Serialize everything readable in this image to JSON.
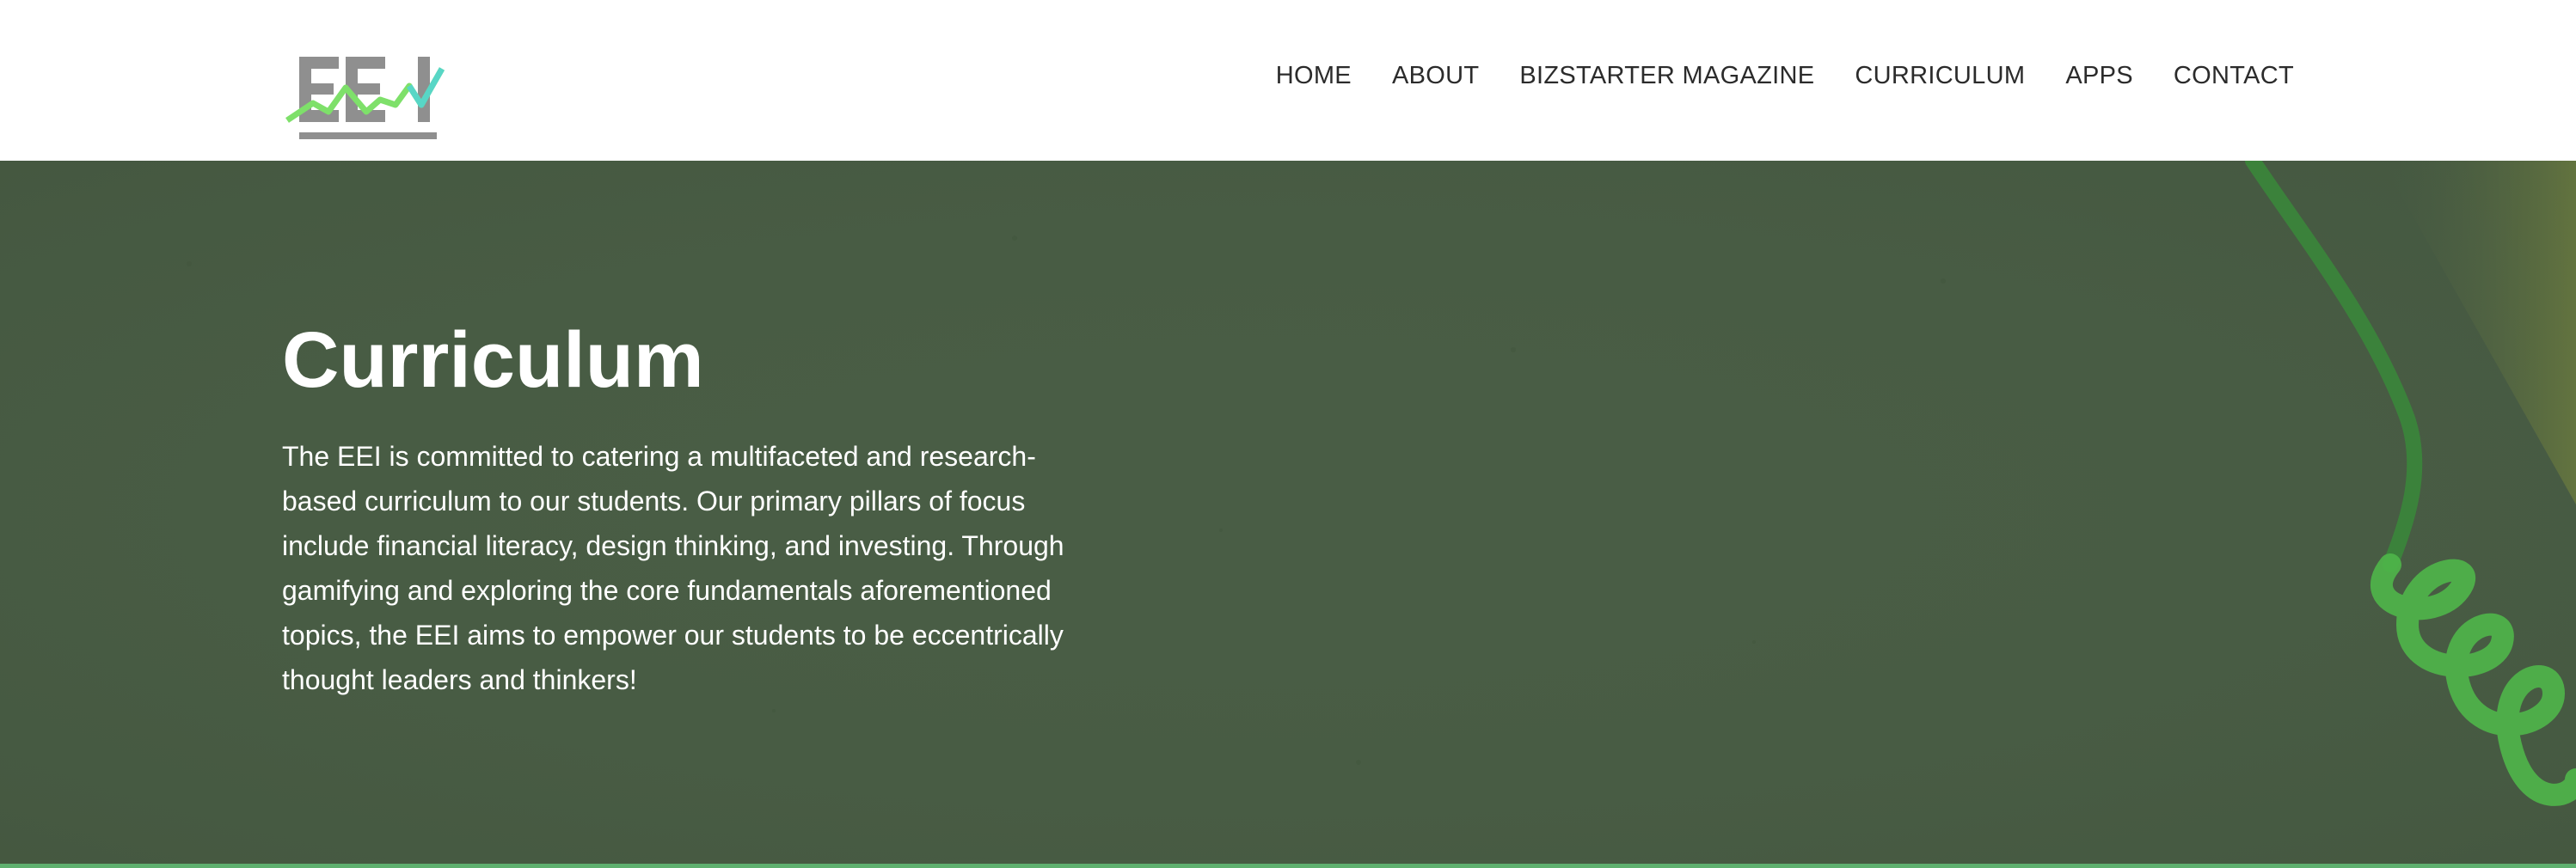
{
  "header": {
    "logo_text": "EEI",
    "nav": [
      {
        "label": "HOME"
      },
      {
        "label": "ABOUT"
      },
      {
        "label": "BIZSTARTER MAGAZINE"
      },
      {
        "label": "CURRICULUM"
      },
      {
        "label": "APPS"
      },
      {
        "label": "CONTACT"
      }
    ]
  },
  "hero": {
    "title": "Curriculum",
    "body": "The EEI is committed to catering a multifaceted and research-based curriculum to our students. Our primary pillars of focus include financial literacy, design thinking, and investing. Through gamifying and exploring the core fundamentals aforementioned topics, the EEI aims to empower our students to be eccentrically thought leaders and thinkers!"
  },
  "colors": {
    "hero_background": "#495d45",
    "logo_gray": "#8f8f8f",
    "logo_green": "#7ee06a",
    "logo_teal": "#58d6c6",
    "accent_bar": "#5fb06f",
    "nav_text": "#2b2b2b"
  }
}
